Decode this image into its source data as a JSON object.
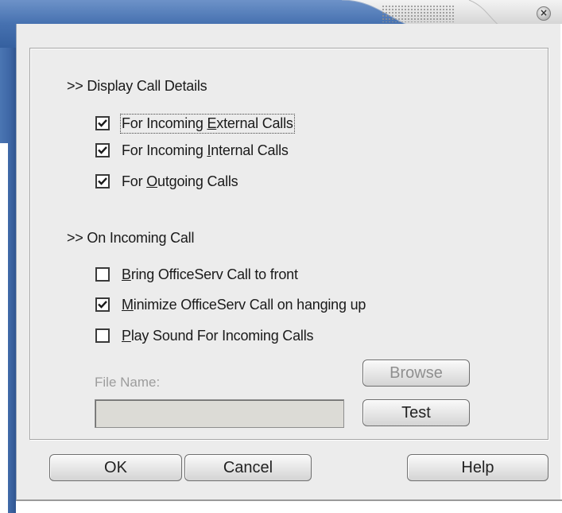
{
  "window": {
    "close_glyph": "×",
    "accent_color": "#3e67a6"
  },
  "display_section": {
    "header": ">> Display Call Details",
    "options": [
      {
        "label": "For Incoming External Calls",
        "checked": true,
        "mnemonic": "E"
      },
      {
        "label": "For Incoming Internal Calls",
        "checked": true,
        "mnemonic": "I"
      },
      {
        "label": "For Outgoing Calls",
        "checked": true,
        "mnemonic": "O"
      }
    ]
  },
  "incoming_section": {
    "header": ">> On Incoming Call",
    "options": [
      {
        "label": "Bring OfficeServ Call to front",
        "checked": false,
        "mnemonic": "B"
      },
      {
        "label": "Minimize OfficeServ Call on hanging up",
        "checked": true,
        "mnemonic": "M"
      },
      {
        "label": "Play Sound For Incoming Calls",
        "checked": false,
        "mnemonic": "P"
      }
    ]
  },
  "sound_file": {
    "label": "File Name:",
    "value": "",
    "browse_label": "Browse",
    "test_label": "Test"
  },
  "buttons": {
    "ok_label": "OK",
    "cancel_label": "Cancel",
    "help_label": "Help"
  }
}
